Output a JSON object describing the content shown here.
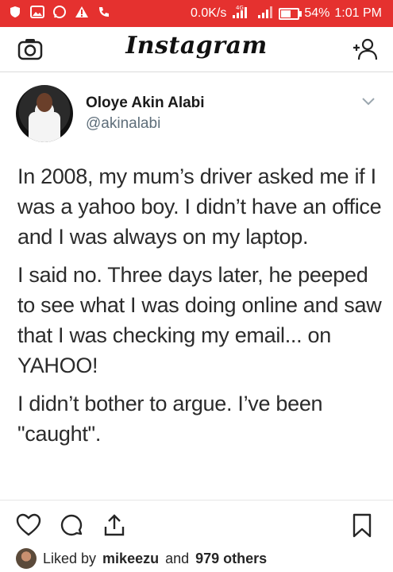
{
  "status_bar": {
    "speed": "0.0K/s",
    "network": "4G",
    "battery": "54%",
    "battery_level": 0.54,
    "time": "1:01 PM"
  },
  "header": {
    "logo": "Instagram",
    "left_icon": "camera-icon",
    "right_icon": "add-person-icon"
  },
  "tweet": {
    "display_name": "Oloye Akin Alabi",
    "handle": "@akinalabi",
    "paragraphs": [
      "In 2008, my mum’s driver asked me if I was a yahoo boy. I didn’t have an office and I was always on my laptop.",
      "I said no. Three days later, he peeped to see what I was doing online and saw that I was checking my email... on YAHOO!",
      "I didn’t bother to argue. I’ve been \"caught\"."
    ]
  },
  "actions": {
    "icons": [
      "heart-icon",
      "comment-icon",
      "share-icon",
      "bookmark-icon"
    ]
  },
  "likes": {
    "prefix": "Liked by",
    "user": "mikeezu",
    "connector": "and",
    "others": "979 others"
  },
  "colors": {
    "status_bar": "#e5312f",
    "handle": "#5e6e7a"
  }
}
